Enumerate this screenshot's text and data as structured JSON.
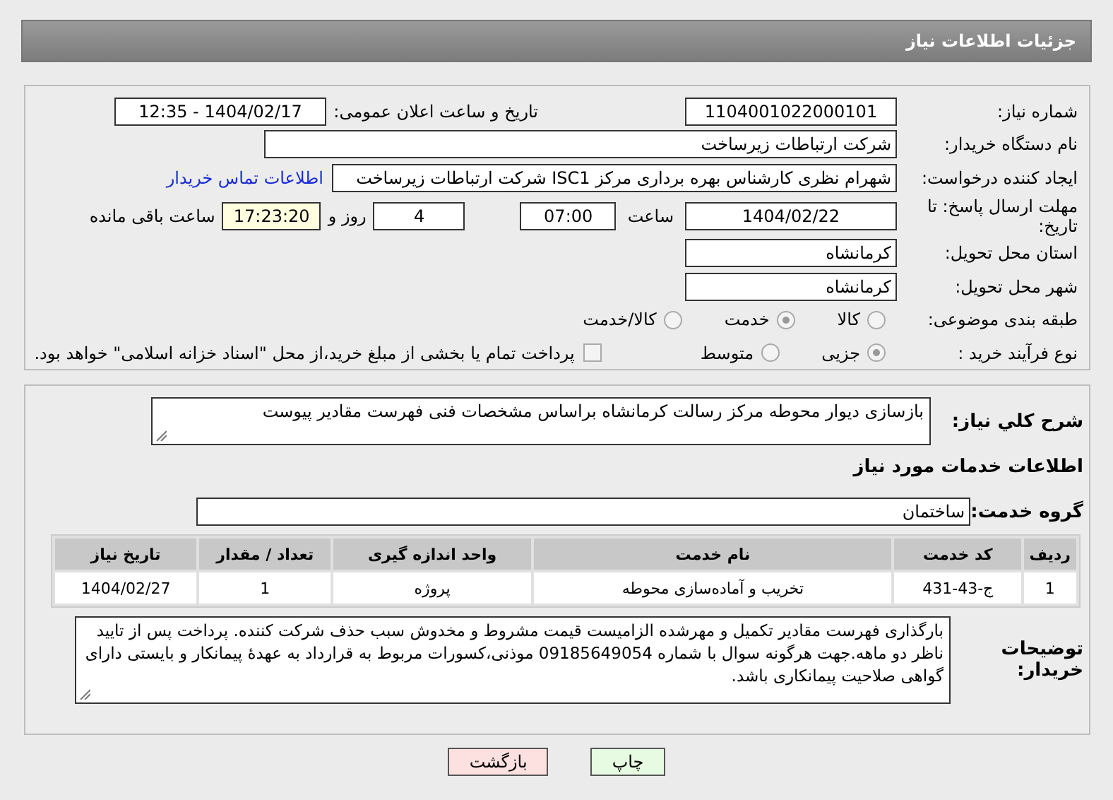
{
  "header": {
    "title": "جزئیات اطلاعات نیاز"
  },
  "need_number": {
    "label": "شماره نیاز:",
    "value": "1104001022000101"
  },
  "announce": {
    "label": "تاریخ و ساعت اعلان عمومی:",
    "value": "1404/02/17 - 12:35"
  },
  "buyer": {
    "label": "نام دستگاه خریدار:",
    "value": "شرکت ارتباطات زیرساخت"
  },
  "requester": {
    "label": "ایجاد کننده درخواست:",
    "value": "شهرام نظری کارشناس بهره برداری مرکز ISC1 شرکت ارتباطات زیرساخت",
    "link": "اطلاعات تماس خریدار"
  },
  "deadline": {
    "label": "مهلت ارسال پاسخ: تا تاریخ:",
    "date": "1404/02/22",
    "time_label": "ساعت",
    "time": "07:00",
    "days": "4",
    "days_label": "روز و",
    "remaining": "17:23:20",
    "remaining_label": "ساعت باقی مانده"
  },
  "province": {
    "label": "استان محل تحویل:",
    "value": "کرمانشاه"
  },
  "city": {
    "label": "شهر محل تحویل:",
    "value": "کرمانشاه"
  },
  "category": {
    "label": "طبقه بندی موضوعی:",
    "options": [
      {
        "label": "کالا",
        "selected": false
      },
      {
        "label": "خدمت",
        "selected": true
      },
      {
        "label": "کالا/خدمت",
        "selected": false
      }
    ]
  },
  "process": {
    "label": "نوع فرآیند خرید :",
    "options": [
      {
        "label": "جزیی",
        "selected": true
      },
      {
        "label": "متوسط",
        "selected": false
      }
    ],
    "payment": {
      "checked": false,
      "text": "پرداخت تمام یا بخشی از مبلغ خرید،از محل \"اسناد خزانه اسلامی\" خواهد بود."
    }
  },
  "description": {
    "label": "شرح کلي نياز:",
    "value": "بازسازی دیوار محوطه مرکز رسالت کرمانشاه براساس مشخصات فنی فهرست مقادیر پیوست"
  },
  "services_heading": "اطلاعات خدمات مورد نیاز",
  "service_group": {
    "label": "گروه خدمت:",
    "value": "ساختمان"
  },
  "table": {
    "columns": [
      "ردیف",
      "کد خدمت",
      "نام خدمت",
      "واحد اندازه گیری",
      "تعداد / مقدار",
      "تاریخ نیاز"
    ],
    "rows": [
      [
        "1",
        "ج-43-431",
        "تخریب و آماده‌سازی محوطه",
        "پروژه",
        "1",
        "1404/02/27"
      ]
    ]
  },
  "buyer_notes": {
    "label": "توضیحات خریدار:",
    "value": "بارگذاری فهرست مقادیر تکمیل و مهرشده الزامیست قیمت مشروط و مخدوش سبب حذف شرکت کننده. پرداخت پس از تایید ناظر دو ماهه.جهت هرگونه سوال با شماره 09185649054 موذنی،کسورات مربوط به قرارداد به عهدهٔ پیمانکار و بایستی دارای گواهی صلاحیت پیمانکاری باشد."
  },
  "buttons": [
    {
      "label": "چاپ",
      "kind": "print"
    },
    {
      "label": "بازگشت",
      "kind": "back"
    }
  ]
}
